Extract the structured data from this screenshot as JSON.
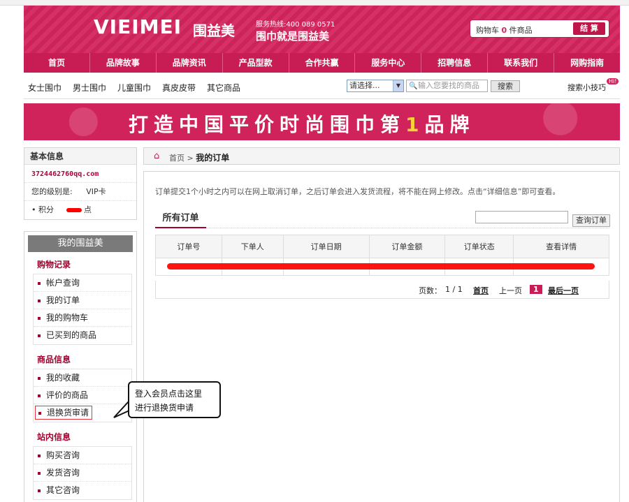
{
  "header": {
    "logo": "VIEIMEI",
    "logo_cn": "围益美",
    "hotline": "服务热线:400 089 0571",
    "slogan": "围巾就是围益美",
    "cart_label": "购物车",
    "cart_count": "0",
    "cart_unit": "件商品",
    "checkout": "结 算"
  },
  "nav": [
    "首页",
    "品牌故事",
    "品牌资讯",
    "产品型款",
    "合作共赢",
    "服务中心",
    "招聘信息",
    "联系我们",
    "网购指南"
  ],
  "categories": [
    "女士围巾",
    "男士围巾",
    "儿童围巾",
    "真皮皮带",
    "其它商品"
  ],
  "search": {
    "select_value": "请选择...",
    "placeholder": "输入您要找的商品",
    "button": "搜索",
    "tips": "搜索小技巧",
    "hot": "Hi!"
  },
  "banner": {
    "pre": "打造中国平价时尚围巾第",
    "num": "1",
    "post": "品牌"
  },
  "basic": {
    "title": "基本信息",
    "email": "3724462760qq.com",
    "level_label": "您的级别是:",
    "level": "VIP卡",
    "points_label": "积分",
    "points_unit": "点"
  },
  "my": {
    "title": "我的围益美",
    "sections": [
      {
        "title": "购物记录",
        "items": [
          "帐户查询",
          "我的订单",
          "我的购物车",
          "已买到的商品"
        ]
      },
      {
        "title": "商品信息",
        "items": [
          "我的收藏",
          "评价的商品",
          "退换货审请"
        ]
      },
      {
        "title": "站内信息",
        "items": [
          "购买咨询",
          "发货咨询",
          "其它咨询"
        ]
      }
    ]
  },
  "breadcrumb": {
    "home": "首页",
    "sep": ">",
    "current": "我的订单"
  },
  "main": {
    "notice": "订单提交1个小时之内可以在网上取消订单，之后订单会进入发货流程，将不能在网上修改。点击“详细信息”即可查看。",
    "tab": "所有订单",
    "query_button": "查询订单",
    "columns": [
      "订单号",
      "下单人",
      "订单日期",
      "订单金额",
      "订单状态",
      "查看详情"
    ],
    "row": [
      "",
      "",
      "",
      "",
      "",
      ""
    ],
    "pager": {
      "label": "页数：",
      "pages": "1 / 1",
      "first": "首页",
      "prev": "上一页",
      "current": "1",
      "last": "最后一页"
    }
  },
  "callout": {
    "line1": "登入会员点击这里",
    "line2": "进行退换货申请"
  }
}
